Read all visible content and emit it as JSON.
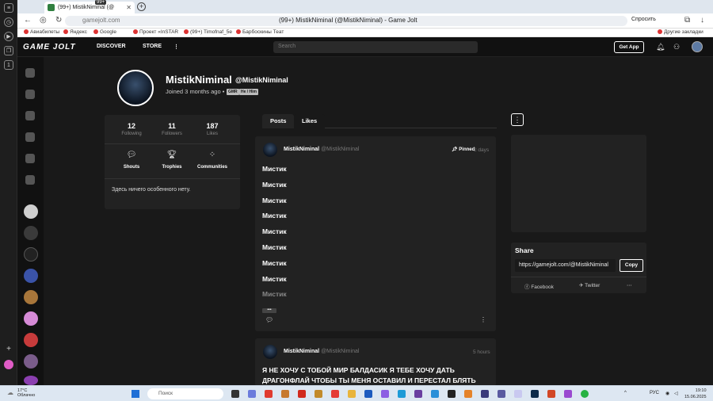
{
  "browser": {
    "tab_title": "(99+) MistikNiminal (@",
    "tab_badge": "99+",
    "url": "gamejolt.com",
    "page_title": "(99+) MistikNiminal (@MistikNiminal) - Game Jolt",
    "ask_label": "Спросить",
    "bookmarks": [
      "Авиабилеты",
      "Яндекс",
      "Google",
      "Проект «InSTAR",
      "(99+) Timofnaf_5e",
      "Барбоскины Теат"
    ],
    "other_bookmarks": "Другие закладки"
  },
  "header": {
    "logo": "GAME JOLT",
    "discover": "DISCOVER",
    "store": "STORE",
    "search_placeholder": "Search",
    "get_app": "Get App"
  },
  "profile": {
    "display_name": "MistikNiminal",
    "handle": "@MistikNiminal",
    "joined": "Joined 3 months ago",
    "tags": [
      "GMR",
      "He / Him"
    ],
    "stats": [
      {
        "value": "12",
        "label": "Following"
      },
      {
        "value": "11",
        "label": "Followers"
      },
      {
        "value": "187",
        "label": "Likes"
      }
    ],
    "features": [
      "Shouts",
      "Trophies",
      "Communities"
    ],
    "about": "Здесь ничего особенного нету."
  },
  "tabs": [
    "Posts",
    "Likes"
  ],
  "posts": [
    {
      "name": "MistikNiminal",
      "handle": "@MistikNiminal",
      "pinned": "Pinned",
      "time": "2 days",
      "lines": [
        "Мистик",
        "Мистик",
        "Мистик",
        "Мистик",
        "Мистик",
        "Мистик",
        "Мистик",
        "Мистик",
        "Мистик"
      ]
    },
    {
      "name": "MistikNiminal",
      "handle": "@MistikNiminal",
      "time": "5 hours",
      "text": "Я НЕ ХОЧУ С ТОБОЙ МИР БАЛДАСИК Я ТЕБЕ ХОЧУ ДАТЬ ДРАГОНФЛАЙ ЧТОБЫ ТЫ МЕНЯ ОСТАВИЛ И ПЕРЕСТАЛ БЛЯТЬ"
    }
  ],
  "share": {
    "title": "Share",
    "url": "https://gamejolt.com/@MistikNiminal",
    "copy": "Copy",
    "facebook": "Facebook",
    "twitter": "Twitter"
  },
  "taskbar": {
    "temp": "17°C",
    "weather": "Облачно",
    "search": "Поиск",
    "lang": "РУС",
    "time": "19:10",
    "date": "15.06.2025"
  }
}
